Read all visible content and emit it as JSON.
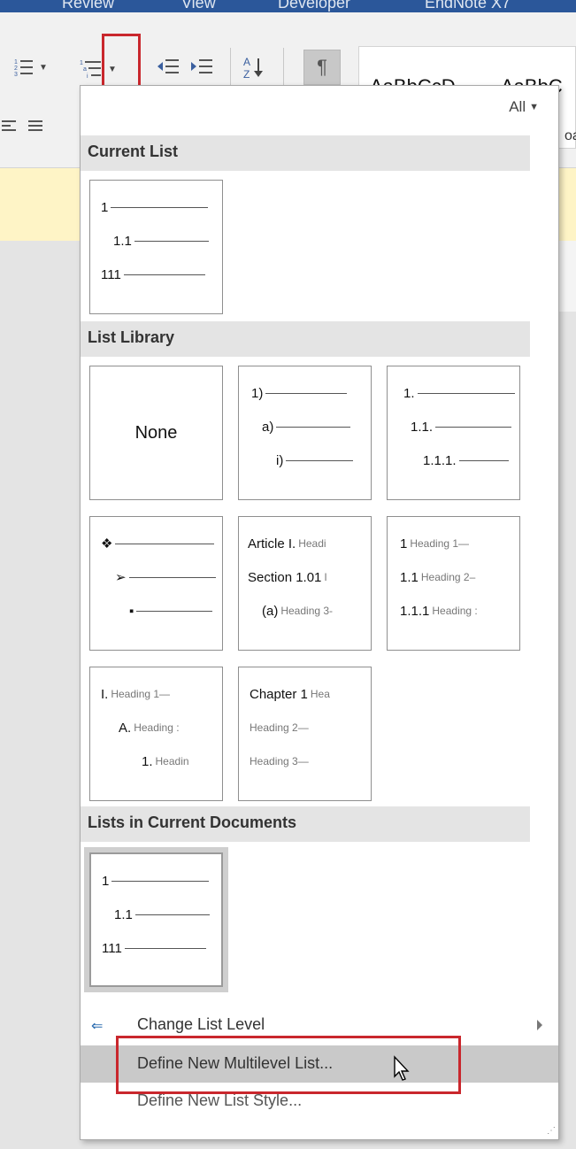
{
  "ribbon": {
    "tabs": [
      "Review",
      "View",
      "Developer",
      "EndNote X7"
    ],
    "sort_icon": "sort-az-icon",
    "pilcrow_glyph": "¶",
    "styles": [
      "AaBbCcD",
      "AaBbC"
    ],
    "clipped_text": "oa"
  },
  "menu": {
    "filter_label": "All",
    "sections": {
      "current": "Current List",
      "library": "List Library",
      "documents": "Lists in Current Documents"
    },
    "current_list": {
      "rows": [
        "1",
        "1.1",
        "111"
      ]
    },
    "library": {
      "none_label": "None",
      "tile_numbered_paren": {
        "rows": [
          "1)",
          "a)",
          "i)"
        ]
      },
      "tile_decimal": {
        "rows": [
          "1.",
          "1.1.",
          "1.1.1."
        ]
      },
      "tile_bullets": {
        "rows": [
          "❖",
          "➢",
          "▪"
        ]
      },
      "tile_article": {
        "rows": [
          {
            "main": "Article I.",
            "sub": "Headi"
          },
          {
            "main": "Section 1.01",
            "sub": "I"
          },
          {
            "main": "(a)",
            "sub": "Heading 3-"
          }
        ]
      },
      "tile_heading_numbers": {
        "rows": [
          {
            "main": "1",
            "sub": "Heading 1—"
          },
          {
            "main": "1.1",
            "sub": "Heading 2–"
          },
          {
            "main": "1.1.1",
            "sub": "Heading :"
          }
        ]
      },
      "tile_roman": {
        "rows": [
          {
            "main": "I.",
            "sub": "Heading 1—"
          },
          {
            "main": "A.",
            "sub": "Heading :"
          },
          {
            "main": "1.",
            "sub": "Headin"
          }
        ]
      },
      "tile_chapter": {
        "rows": [
          {
            "main": "Chapter 1",
            "sub": "Hea"
          },
          {
            "main": "",
            "sub": "Heading 2—"
          },
          {
            "main": "",
            "sub": "Heading 3—"
          }
        ]
      }
    },
    "document_list": {
      "rows": [
        "1",
        "1.1",
        "111"
      ]
    },
    "commands": {
      "change_level": "Change List Level",
      "define_multilevel": "Define New Multilevel List...",
      "define_style": "Define New List Style..."
    }
  },
  "colors": {
    "highlight_red": "#c9272d",
    "ribbon_blue": "#2b579a",
    "doc_yellow": "#fef4c6"
  }
}
